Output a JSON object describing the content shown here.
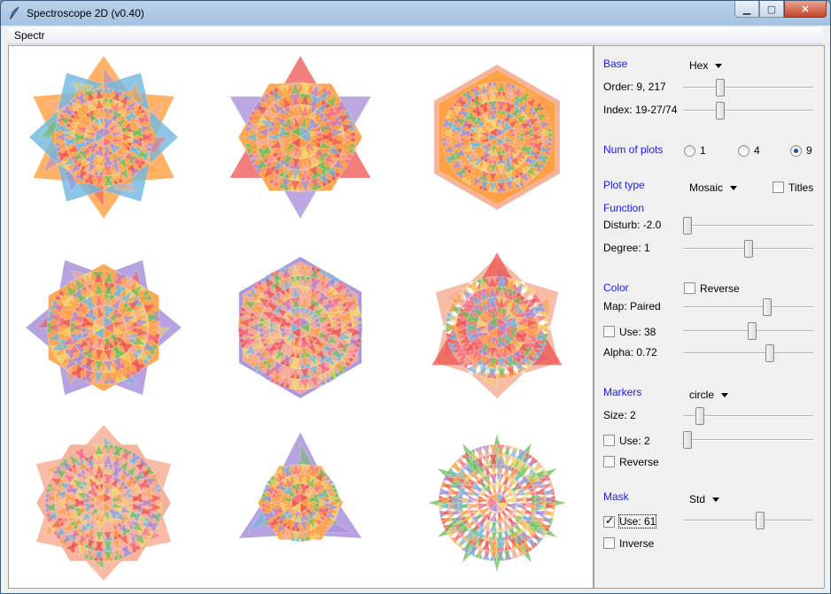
{
  "window": {
    "title": "Spectroscope 2D (v0.40)",
    "buttons": {
      "minimize": "▁",
      "maximize": "▢",
      "close": "✕"
    }
  },
  "menu": {
    "items": [
      "Spectr"
    ]
  },
  "panel": {
    "base": {
      "heading": "Base",
      "value": "Hex"
    },
    "order": {
      "label": "Order: 9, 217",
      "level": 0.27
    },
    "index": {
      "label": "Index: 19-27/74",
      "level": 0.27
    },
    "num_plots": {
      "heading": "Num of plots",
      "options": [
        "1",
        "4",
        "9"
      ],
      "selected": "9"
    },
    "plot_type": {
      "heading": "Plot type",
      "value": "Mosaic",
      "titles_label": "Titles",
      "titles_checked": false
    },
    "function": {
      "heading": "Function"
    },
    "disturb": {
      "label": "Disturb: -2.0",
      "level": 0.0
    },
    "degree": {
      "label": "Degree: 1",
      "level": 0.5
    },
    "color": {
      "heading": "Color",
      "reverse_label": "Reverse",
      "reverse_checked": false
    },
    "map": {
      "label": "Map: Paired",
      "level": 0.66
    },
    "use_color": {
      "label": "Use: 38",
      "checked": false,
      "level": 0.53
    },
    "alpha": {
      "label": "Alpha: 0.72",
      "level": 0.68
    },
    "markers": {
      "heading": "Markers",
      "value": "circle"
    },
    "size": {
      "label": "Size: 2",
      "level": 0.1
    },
    "use_markers": {
      "label": "Use: 2",
      "checked": false,
      "level": 0.0
    },
    "marker_reverse": {
      "label": "Reverse",
      "checked": false
    },
    "mask": {
      "heading": "Mask",
      "value": "Std"
    },
    "use_mask": {
      "label": "Use: 61",
      "checked": true,
      "level": 0.6
    },
    "inverse": {
      "label": "Inverse",
      "checked": false
    }
  },
  "colors": [
    "#ff9f40",
    "#ef5450",
    "#6cbf5c",
    "#a48bd8",
    "#f6aa8f",
    "#71b6e0",
    "#f1d46a",
    "#f26d85"
  ],
  "plots": [
    {
      "shape": "star6",
      "rot": 0
    },
    {
      "shape": "triangle",
      "rot": 0
    },
    {
      "shape": "hexagon",
      "rot": 0
    },
    {
      "shape": "star6b",
      "rot": 0
    },
    {
      "shape": "hexagon2",
      "rot": 0
    },
    {
      "shape": "triangleb",
      "rot": 0
    },
    {
      "shape": "star6c",
      "rot": 0
    },
    {
      "shape": "trianglec",
      "rot": 0
    },
    {
      "shape": "circle",
      "rot": 0
    }
  ]
}
